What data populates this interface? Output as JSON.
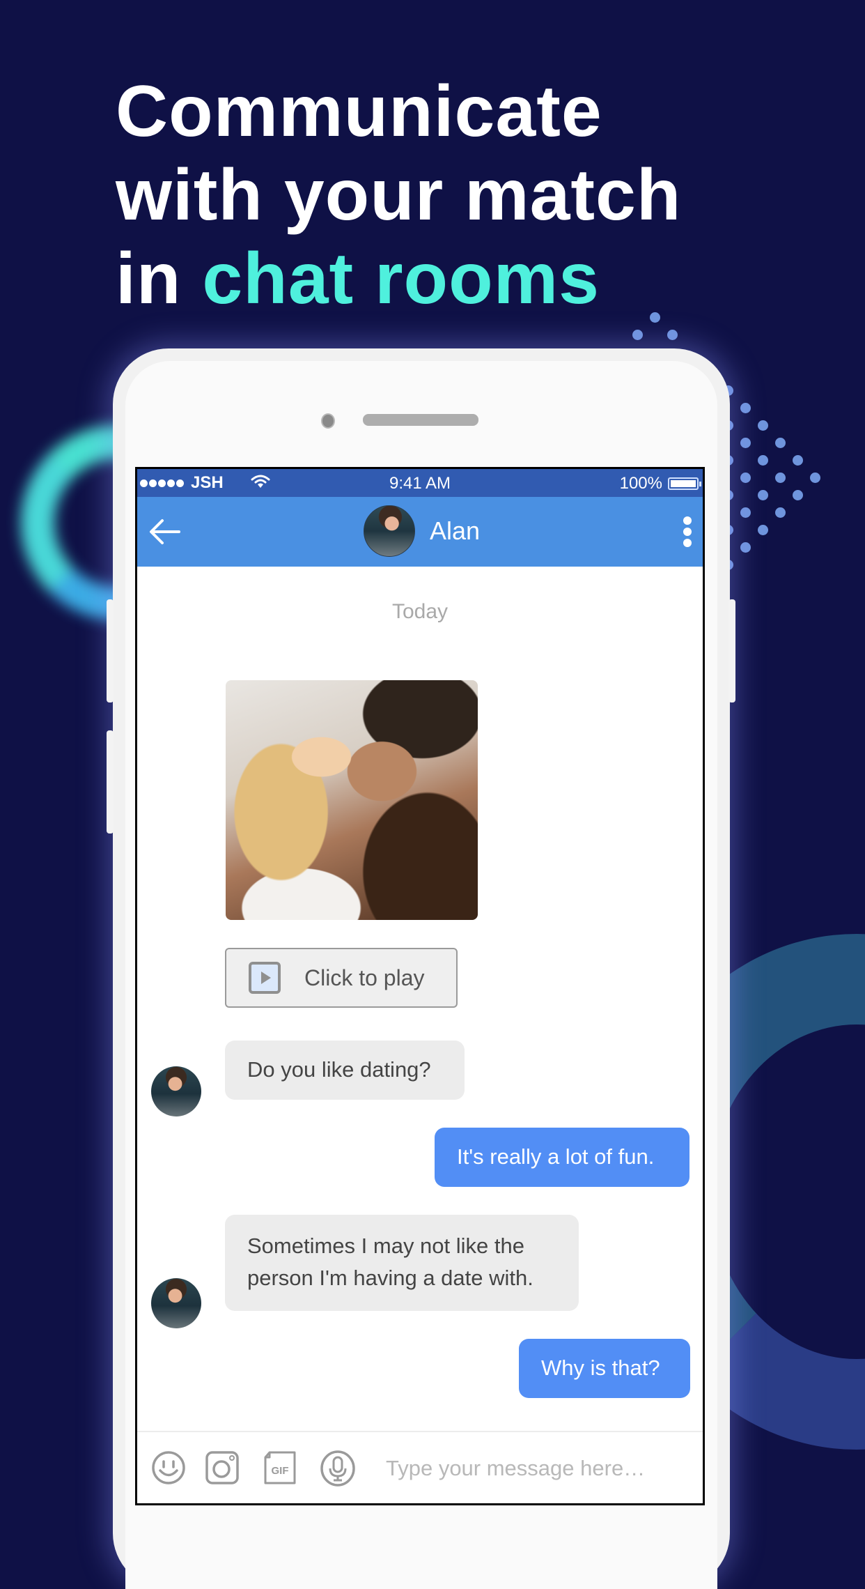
{
  "headline": {
    "line1": "Communicate",
    "line2": "with your match",
    "line3_prefix": "in ",
    "line3_accent": "chat rooms"
  },
  "colors": {
    "background": "#0f1146",
    "accent_teal": "#4ff0dd",
    "status_bar": "#315bb1",
    "nav_bar": "#4a90e2",
    "outgoing_bubble": "#528ef5",
    "incoming_bubble": "#ececec"
  },
  "status_bar": {
    "signal_icon": "signal-dots-icon",
    "carrier": "JSH",
    "wifi_icon": "wifi-icon",
    "time": "9:41 AM",
    "battery_percent": "100%",
    "battery_level": 1.0,
    "battery_icon": "battery-icon"
  },
  "nav_bar": {
    "back_icon": "arrow-left-icon",
    "contact_name": "Alan",
    "more_icon": "more-vertical-icon"
  },
  "chat": {
    "date_divider": "Today",
    "media": {
      "photo_alt": "Couple photo",
      "play_button_icon": "play-icon",
      "play_button_label": "Click to play"
    },
    "messages": [
      {
        "direction": "incoming",
        "sender": "Alan",
        "text": "Do you like dating?"
      },
      {
        "direction": "outgoing",
        "text": "It's really a lot of fun."
      },
      {
        "direction": "incoming",
        "sender": "Alan",
        "text": "Sometimes I may not like the person I'm having a date with."
      },
      {
        "direction": "outgoing",
        "text": "Why is that?"
      }
    ]
  },
  "input_bar": {
    "icons": [
      "emoji-icon",
      "camera-icon",
      "gif-icon",
      "microphone-icon"
    ],
    "gif_label": "GIF",
    "placeholder": "Type your message here…",
    "value": ""
  }
}
